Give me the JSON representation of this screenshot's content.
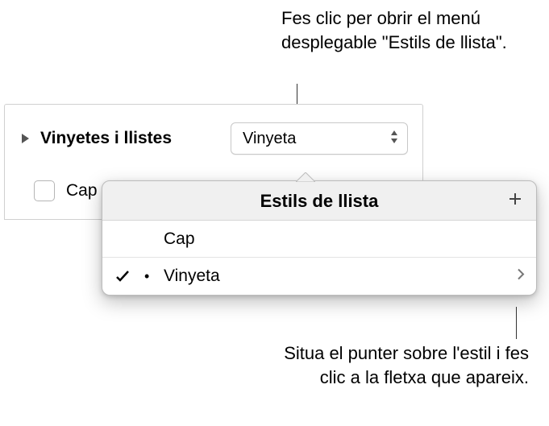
{
  "callouts": {
    "top": "Fes clic per obrir el menú desplegable \"Estils de llista\".",
    "bottom": "Situa el punter sobre l'estil i fes clic a la fletxa que apareix."
  },
  "panel": {
    "section_label": "Vinyetes i llistes",
    "popup_value": "Vinyeta",
    "cap_label": "Cap"
  },
  "popover": {
    "title": "Estils de llista",
    "items": [
      {
        "label": "Cap",
        "selected": false,
        "bullet": ""
      },
      {
        "label": "Vinyeta",
        "selected": true,
        "bullet": "•"
      }
    ]
  }
}
